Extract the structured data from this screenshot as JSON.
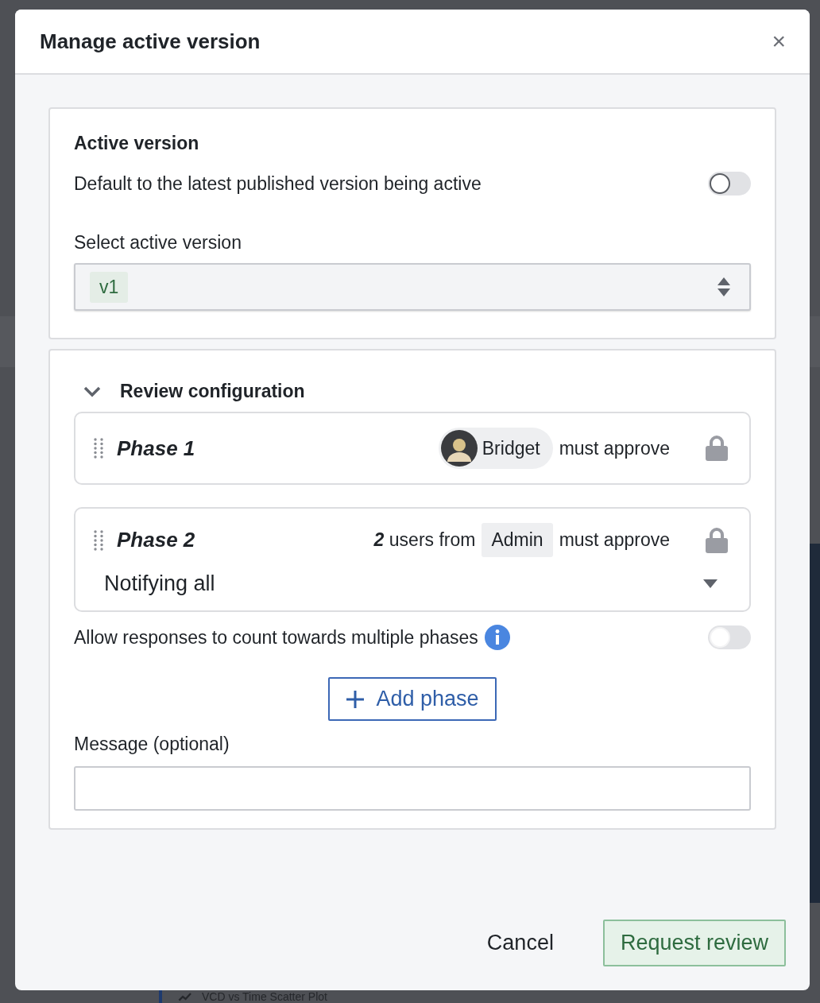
{
  "background": {
    "panel_title": "VCD vs Time Scatter Plot"
  },
  "dialog": {
    "title": "Manage active version",
    "close": "×"
  },
  "active_version": {
    "heading": "Active version",
    "default_toggle": {
      "label": "Default to the latest published version being active",
      "on": false
    },
    "select_label": "Select active version",
    "selected_value": "v1"
  },
  "review": {
    "heading": "Review configuration",
    "expanded": true,
    "phases": [
      {
        "name": "Phase 1",
        "kind": "user",
        "user": "Bridget",
        "suffix": "must approve",
        "locked": true
      },
      {
        "name": "Phase 2",
        "kind": "group",
        "count": "2",
        "count_text": "users from",
        "group": "Admin",
        "suffix": "must approve",
        "locked": true,
        "notify": "Notifying all"
      }
    ],
    "multi_toggle": {
      "label": "Allow responses to count towards multiple phases",
      "on": false
    },
    "add_button": "Add phase",
    "message_label": "Message (optional)"
  },
  "buttons": [
    {
      "label": "Cancel",
      "kind": "secondary"
    },
    {
      "label": "Request review",
      "kind": "primary"
    }
  ]
}
